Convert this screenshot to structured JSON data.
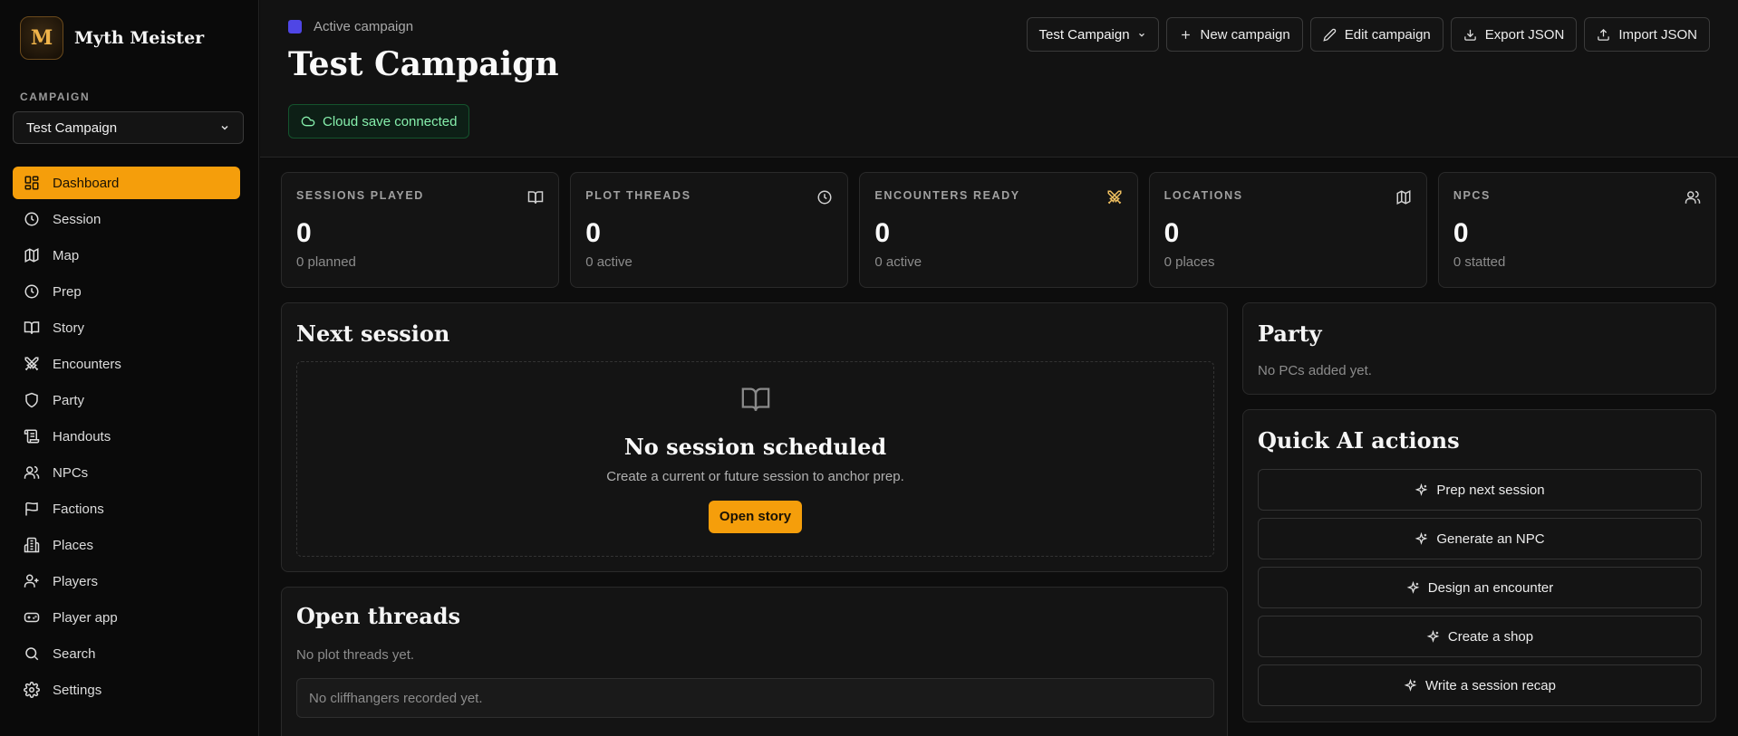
{
  "brand": {
    "name": "Myth Meister",
    "logo_text": "M"
  },
  "sidebar": {
    "campaign_label": "CAMPAIGN",
    "campaign_select": "Test Campaign",
    "items": [
      {
        "label": "Dashboard",
        "icon": "dashboard-icon"
      },
      {
        "label": "Session",
        "icon": "clock-icon"
      },
      {
        "label": "Map",
        "icon": "map-icon"
      },
      {
        "label": "Prep",
        "icon": "clock-icon"
      },
      {
        "label": "Story",
        "icon": "book-icon"
      },
      {
        "label": "Encounters",
        "icon": "swords-icon"
      },
      {
        "label": "Party",
        "icon": "shield-icon"
      },
      {
        "label": "Handouts",
        "icon": "scroll-icon"
      },
      {
        "label": "NPCs",
        "icon": "users-icon"
      },
      {
        "label": "Factions",
        "icon": "flag-icon"
      },
      {
        "label": "Places",
        "icon": "buildings-icon"
      },
      {
        "label": "Players",
        "icon": "user-plus-icon"
      },
      {
        "label": "Player app",
        "icon": "gamepad-icon"
      },
      {
        "label": "Search",
        "icon": "search-icon"
      },
      {
        "label": "Settings",
        "icon": "gear-icon"
      }
    ]
  },
  "header": {
    "active_label": "Active campaign",
    "title": "Test Campaign",
    "cloud_status": "Cloud save connected",
    "campaign_select": "Test Campaign",
    "new_campaign": "New campaign",
    "edit_campaign": "Edit campaign",
    "export_json": "Export JSON",
    "import_json": "Import JSON"
  },
  "stats": [
    {
      "label": "SESSIONS PLAYED",
      "value": "0",
      "sub": "0 planned",
      "icon": "book-icon"
    },
    {
      "label": "PLOT THREADS",
      "value": "0",
      "sub": "0 active",
      "icon": "clock-icon"
    },
    {
      "label": "ENCOUNTERS READY",
      "value": "0",
      "sub": "0 active",
      "icon": "swords-icon"
    },
    {
      "label": "LOCATIONS",
      "value": "0",
      "sub": "0 places",
      "icon": "map-icon"
    },
    {
      "label": "NPCS",
      "value": "0",
      "sub": "0 statted",
      "icon": "users-icon"
    }
  ],
  "next_session": {
    "title": "Next session",
    "empty_title": "No session scheduled",
    "empty_text": "Create a current or future session to anchor prep.",
    "button": "Open story"
  },
  "open_threads": {
    "title": "Open threads",
    "empty_text": "No plot threads yet.",
    "cliffhangers": "No cliffhangers recorded yet."
  },
  "party": {
    "title": "Party",
    "empty_text": "No PCs added yet."
  },
  "quick_ai": {
    "title": "Quick AI actions",
    "actions": [
      "Prep next session",
      "Generate an NPC",
      "Design an encounter",
      "Create a shop",
      "Write a session recap"
    ]
  },
  "colors": {
    "accent": "#f59e0b",
    "campaign_color": "#4f46e5",
    "success": "#86efac"
  }
}
